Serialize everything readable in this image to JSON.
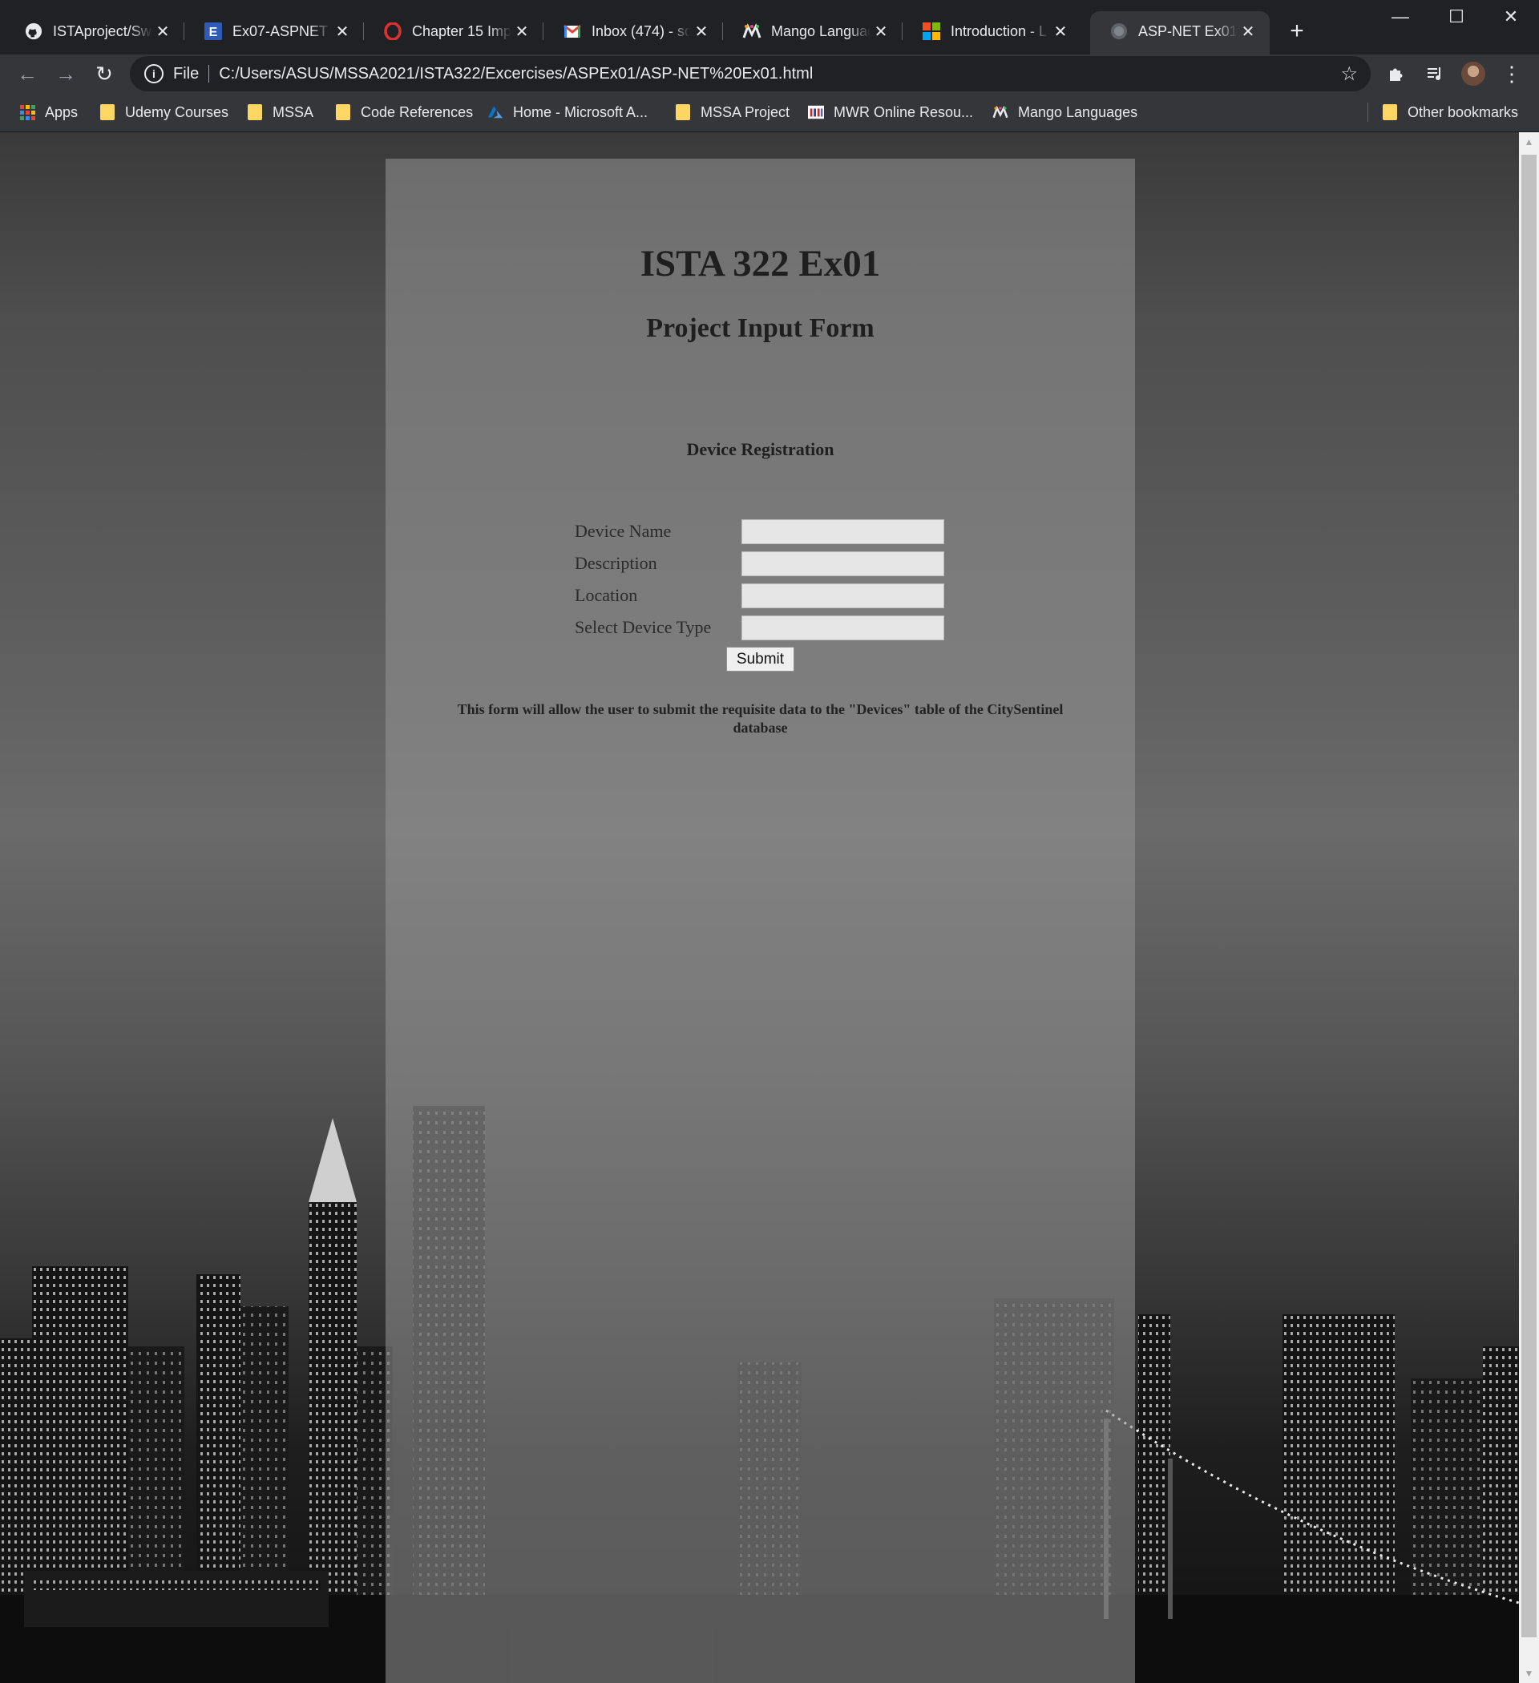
{
  "browser": {
    "tabs": [
      {
        "title": "ISTAproject/SwE",
        "icon": "github-icon"
      },
      {
        "title": "Ex07-ASPNET",
        "icon": "e-app-icon"
      },
      {
        "title": "Chapter 15 Impl",
        "icon": "opera-icon"
      },
      {
        "title": "Inbox (474) - sd",
        "icon": "gmail-icon"
      },
      {
        "title": "Mango Languag",
        "icon": "mango-icon"
      },
      {
        "title": "Introduction - L",
        "icon": "microsoft-icon"
      },
      {
        "title": "ASP-NET Ex01.h",
        "icon": "globe-icon",
        "active": true
      }
    ],
    "address": {
      "scheme": "File",
      "url": "C:/Users/ASUS/MSSA2021/ISTA322/Excercises/ASPEx01/ASP-NET%20Ex01.html"
    },
    "bookmarks": [
      {
        "label": "Apps",
        "icon": "apps-grid-icon"
      },
      {
        "label": "Udemy Courses",
        "icon": "folder-icon"
      },
      {
        "label": "MSSA",
        "icon": "folder-icon"
      },
      {
        "label": "Code References",
        "icon": "folder-icon"
      },
      {
        "label": "Home - Microsoft A...",
        "icon": "azure-icon"
      },
      {
        "label": "MSSA Project",
        "icon": "folder-icon"
      },
      {
        "label": "MWR Online Resou...",
        "icon": "mwr-icon"
      },
      {
        "label": "Mango Languages",
        "icon": "mango-icon"
      }
    ],
    "other_bookmarks": "Other bookmarks"
  },
  "page": {
    "title": "ISTA 322 Ex01",
    "subtitle": "Project Input Form",
    "section": "Device Registration",
    "fields": [
      {
        "label": "Device Name",
        "value": ""
      },
      {
        "label": "Description",
        "value": ""
      },
      {
        "label": "Location",
        "value": ""
      },
      {
        "label": "Select Device Type",
        "value": ""
      }
    ],
    "submit_label": "Submit",
    "note": "This form will allow the user to submit the requisite data to the \"Devices\" table of the CitySentinel database"
  },
  "colors": {
    "chrome_dark": "#202124",
    "chrome_toolbar": "#35363a",
    "panel_overlay": "#969696"
  }
}
